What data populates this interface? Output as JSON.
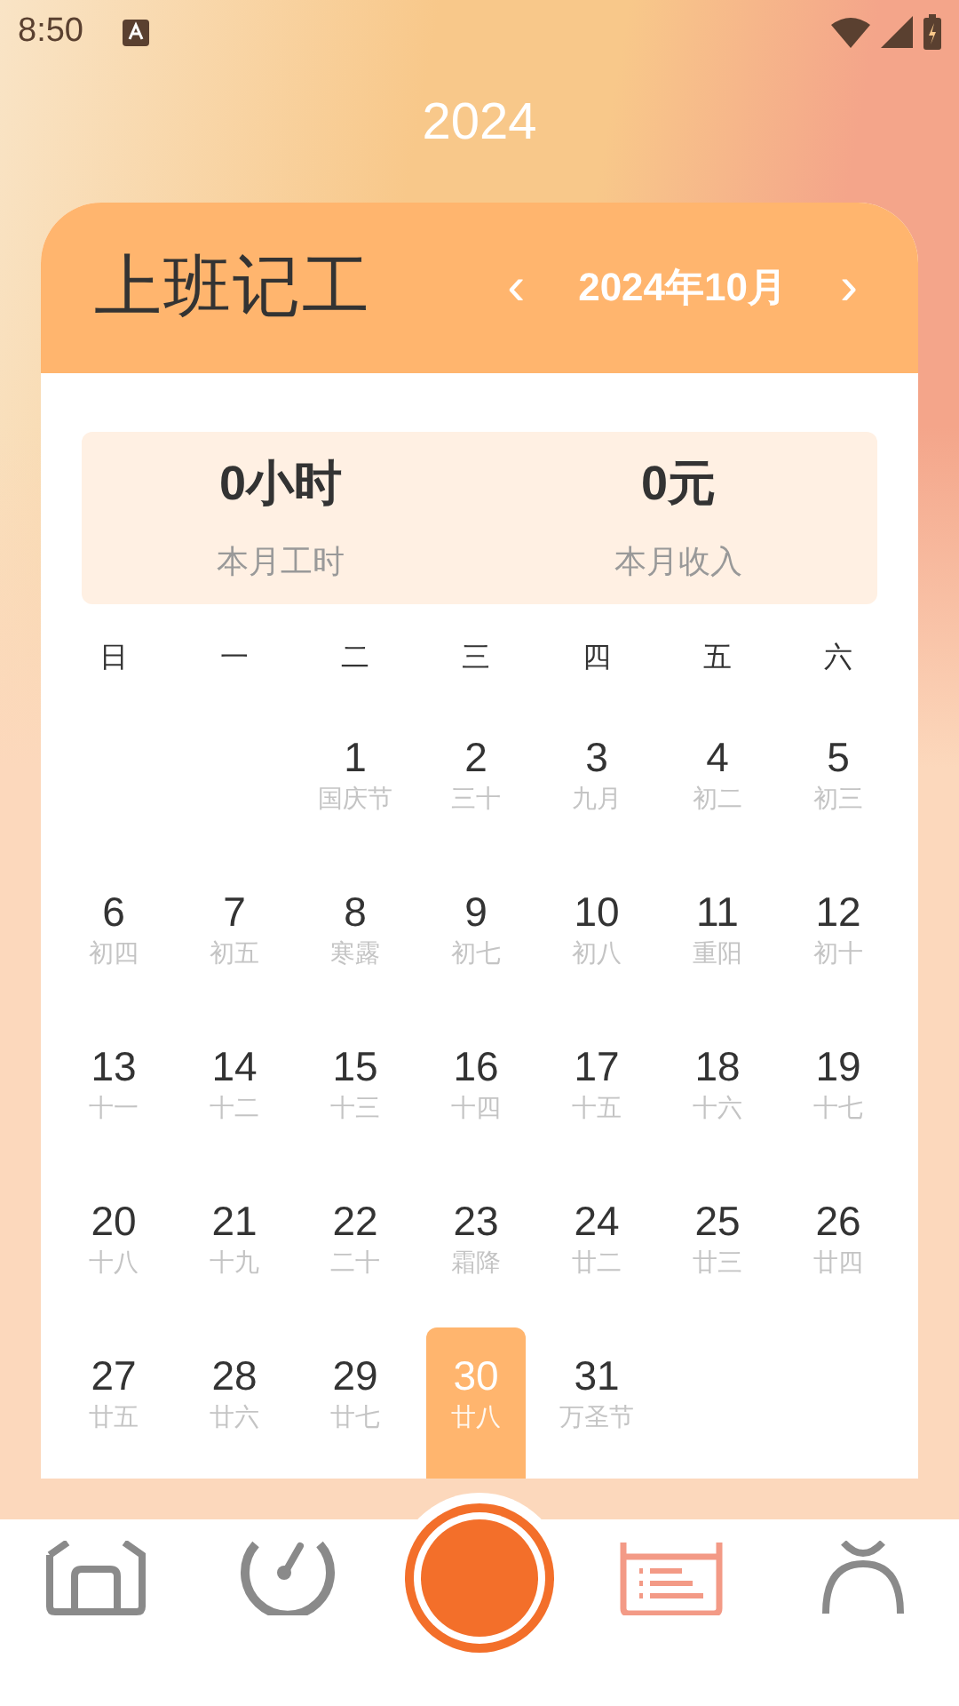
{
  "status_bar": {
    "time": "8:50"
  },
  "year": "2024",
  "header": {
    "title": "上班记工",
    "prev": "‹",
    "month": "2024年10月",
    "next": "›"
  },
  "summary": [
    {
      "value": "0小时",
      "label": "本月工时"
    },
    {
      "value": "0元",
      "label": "本月收入"
    }
  ],
  "weekdays": [
    "日",
    "一",
    "二",
    "三",
    "四",
    "五",
    "六"
  ],
  "days": [
    {
      "kind": "blank"
    },
    {
      "kind": "blank"
    },
    {
      "kind": "date",
      "day": "1",
      "lunar": "国庆节",
      "selected": false
    },
    {
      "kind": "date",
      "day": "2",
      "lunar": "三十",
      "selected": false
    },
    {
      "kind": "date",
      "day": "3",
      "lunar": "九月",
      "selected": false
    },
    {
      "kind": "date",
      "day": "4",
      "lunar": "初二",
      "selected": false
    },
    {
      "kind": "date",
      "day": "5",
      "lunar": "初三",
      "selected": false
    },
    {
      "kind": "date",
      "day": "6",
      "lunar": "初四",
      "selected": false
    },
    {
      "kind": "date",
      "day": "7",
      "lunar": "初五",
      "selected": false
    },
    {
      "kind": "date",
      "day": "8",
      "lunar": "寒露",
      "selected": false
    },
    {
      "kind": "date",
      "day": "9",
      "lunar": "初七",
      "selected": false
    },
    {
      "kind": "date",
      "day": "10",
      "lunar": "初八",
      "selected": false
    },
    {
      "kind": "date",
      "day": "11",
      "lunar": "重阳",
      "selected": false
    },
    {
      "kind": "date",
      "day": "12",
      "lunar": "初十",
      "selected": false
    },
    {
      "kind": "date",
      "day": "13",
      "lunar": "十一",
      "selected": false
    },
    {
      "kind": "date",
      "day": "14",
      "lunar": "十二",
      "selected": false
    },
    {
      "kind": "date",
      "day": "15",
      "lunar": "十三",
      "selected": false
    },
    {
      "kind": "date",
      "day": "16",
      "lunar": "十四",
      "selected": false
    },
    {
      "kind": "date",
      "day": "17",
      "lunar": "十五",
      "selected": false
    },
    {
      "kind": "date",
      "day": "18",
      "lunar": "十六",
      "selected": false
    },
    {
      "kind": "date",
      "day": "19",
      "lunar": "十七",
      "selected": false
    },
    {
      "kind": "date",
      "day": "20",
      "lunar": "十八",
      "selected": false
    },
    {
      "kind": "date",
      "day": "21",
      "lunar": "十九",
      "selected": false
    },
    {
      "kind": "date",
      "day": "22",
      "lunar": "二十",
      "selected": false
    },
    {
      "kind": "date",
      "day": "23",
      "lunar": "霜降",
      "selected": false
    },
    {
      "kind": "date",
      "day": "24",
      "lunar": "廿二",
      "selected": false
    },
    {
      "kind": "date",
      "day": "25",
      "lunar": "廿三",
      "selected": false
    },
    {
      "kind": "date",
      "day": "26",
      "lunar": "廿四",
      "selected": false
    },
    {
      "kind": "date",
      "day": "27",
      "lunar": "廿五",
      "selected": false
    },
    {
      "kind": "date",
      "day": "28",
      "lunar": "廿六",
      "selected": false
    },
    {
      "kind": "date",
      "day": "29",
      "lunar": "廿七",
      "selected": false
    },
    {
      "kind": "date",
      "day": "30",
      "lunar": "廿八",
      "selected": true
    },
    {
      "kind": "date",
      "day": "31",
      "lunar": "万圣节",
      "selected": false
    }
  ],
  "nav": [
    {
      "kind": "home",
      "selected": false
    },
    {
      "kind": "gauge",
      "selected": false
    },
    {
      "kind": "record",
      "selected": false
    },
    {
      "kind": "calendar",
      "selected": true
    },
    {
      "kind": "person",
      "selected": false
    }
  ]
}
